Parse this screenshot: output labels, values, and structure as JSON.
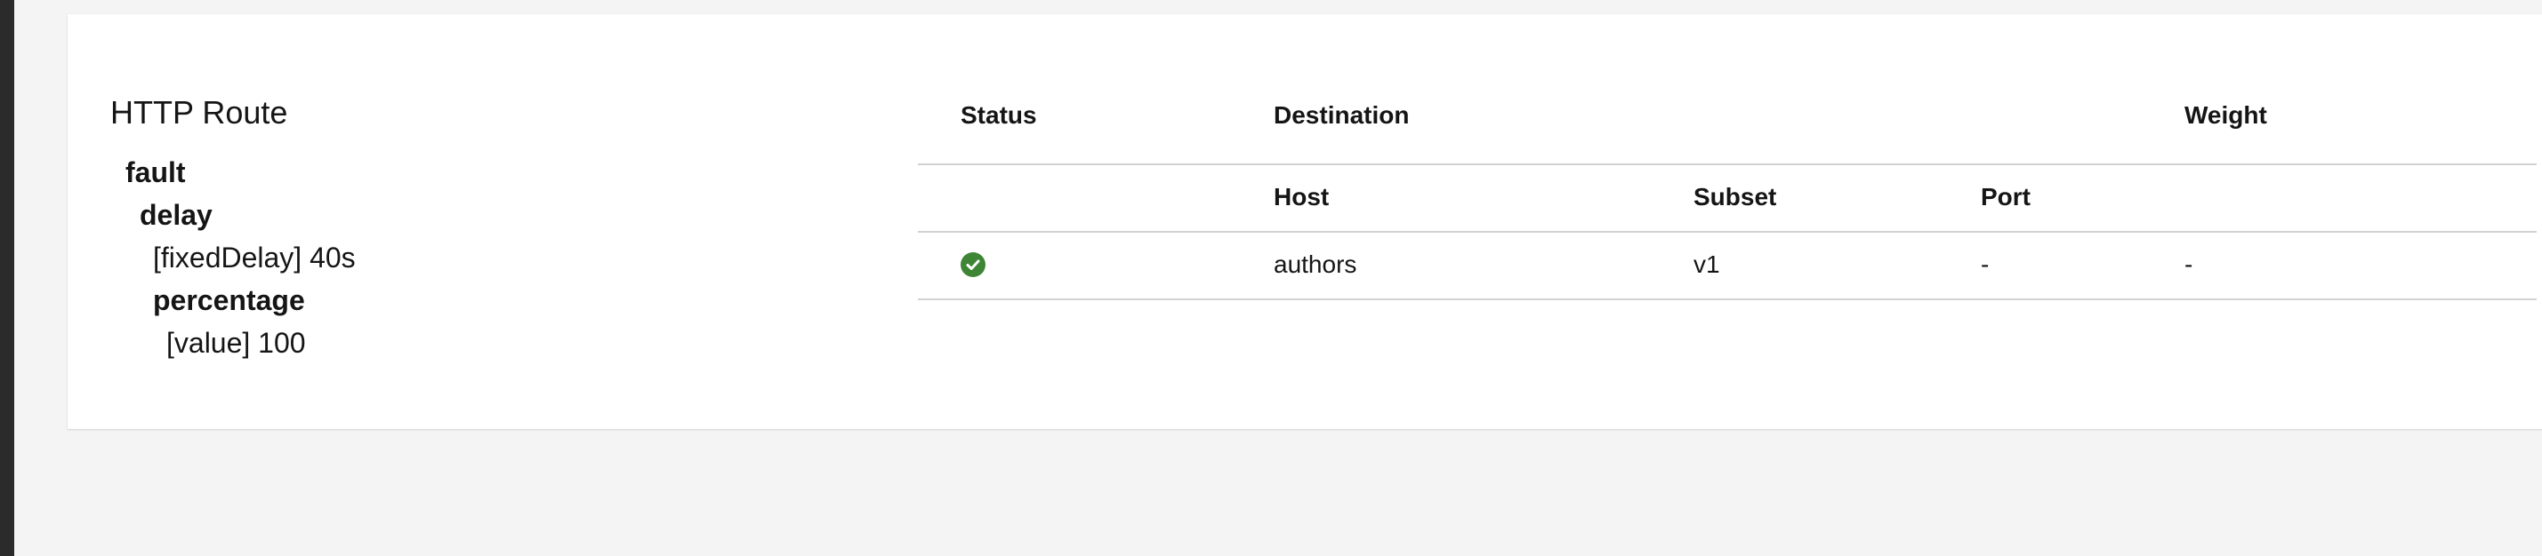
{
  "panel": {
    "title": "HTTP Route",
    "tree": [
      {
        "label": "fault",
        "kind": "key"
      },
      {
        "label": "delay",
        "kind": "key"
      },
      {
        "label": "[fixedDelay] 40s",
        "kind": "value"
      },
      {
        "label": "percentage",
        "kind": "key"
      },
      {
        "label": "[value] 100",
        "kind": "value"
      }
    ]
  },
  "route_table": {
    "headers": {
      "status": "Status",
      "destination": "Destination",
      "weight": "Weight",
      "host": "Host",
      "subset": "Subset",
      "port": "Port"
    },
    "rows": [
      {
        "status_icon": "check-circle-icon",
        "status_color": "#3e8635",
        "host": "authors",
        "subset": "v1",
        "port": "-",
        "weight": "-"
      }
    ]
  }
}
